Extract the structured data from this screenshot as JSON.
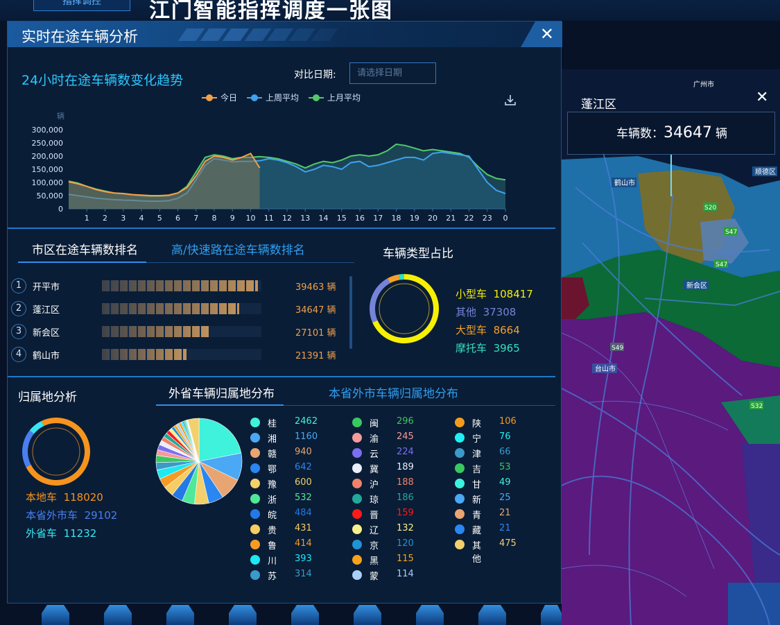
{
  "background": {
    "title": "江门智能指挥调度一张图",
    "nav_tab": "指挥调控"
  },
  "panel": {
    "title": "实时在途车辆分析",
    "close_icon": "close-icon"
  },
  "trend": {
    "title": "24小时在途车辆数变化趋势",
    "compare_label": "对比日期:",
    "date_placeholder": "请选择日期",
    "unit": "辆",
    "download_icon": "download-icon"
  },
  "ranking": {
    "tab_active": "市区在途车辆数排名",
    "tab_other": "高/快速路在途车辆数排名",
    "rows": [
      {
        "rank": "1",
        "name": "开平市",
        "value": 39463,
        "value_text": "39463 辆"
      },
      {
        "rank": "2",
        "name": "蓬江区",
        "value": 34647,
        "value_text": "34647 辆"
      },
      {
        "rank": "3",
        "name": "新会区",
        "value": 27101,
        "value_text": "27101 辆"
      },
      {
        "rank": "4",
        "name": "鹤山市",
        "value": 21391,
        "value_text": "21391 辆"
      }
    ]
  },
  "vehicle_type": {
    "title": "车辆类型占比",
    "items": [
      {
        "label": "小型车",
        "value": "108417",
        "color": "#f7f003"
      },
      {
        "label": "其他",
        "value": "37308",
        "color": "#7584d8"
      },
      {
        "label": "大型车",
        "value": "8664",
        "color": "#f5a127"
      },
      {
        "label": "摩托车",
        "value": "3965",
        "color": "#35e0bf"
      }
    ]
  },
  "origin": {
    "title": "归属地分析",
    "items": [
      {
        "label": "本地车",
        "value": "118020",
        "color": "#f7941d"
      },
      {
        "label": "本省外市车",
        "value": "29102",
        "color": "#4a7ff0"
      },
      {
        "label": "外省车",
        "value": "11232",
        "color": "#38e6f2"
      }
    ]
  },
  "provinces": {
    "tab_active": "外省车辆归属地分布",
    "tab_other": "本省外市车辆归属地分布",
    "items": [
      {
        "name": "桂",
        "value": "2462",
        "color": "#3ef2dc"
      },
      {
        "name": "湘",
        "value": "1160",
        "color": "#4aa8f5"
      },
      {
        "name": "赣",
        "value": "940",
        "color": "#e8a572"
      },
      {
        "name": "鄂",
        "value": "642",
        "color": "#2a86f0"
      },
      {
        "name": "豫",
        "value": "600",
        "color": "#f2d06b"
      },
      {
        "name": "浙",
        "value": "532",
        "color": "#4fe89a"
      },
      {
        "name": "皖",
        "value": "484",
        "color": "#2379e6"
      },
      {
        "name": "贵",
        "value": "431",
        "color": "#f6cd62"
      },
      {
        "name": "鲁",
        "value": "414",
        "color": "#f59b23"
      },
      {
        "name": "川",
        "value": "393",
        "color": "#1ee8f2"
      },
      {
        "name": "苏",
        "value": "314",
        "color": "#3a9ac8"
      },
      {
        "name": "闽",
        "value": "296",
        "color": "#38c860"
      },
      {
        "name": "渝",
        "value": "245",
        "color": "#f59a9a"
      },
      {
        "name": "云",
        "value": "224",
        "color": "#7b6ef0"
      },
      {
        "name": "冀",
        "value": "189",
        "color": "#e9eefc"
      },
      {
        "name": "沪",
        "value": "188",
        "color": "#f0826a"
      },
      {
        "name": "琼",
        "value": "186",
        "color": "#23a89a"
      },
      {
        "name": "晋",
        "value": "159",
        "color": "#ff1a1a"
      },
      {
        "name": "辽",
        "value": "132",
        "color": "#f8f08a"
      },
      {
        "name": "京",
        "value": "120",
        "color": "#1f93d4"
      },
      {
        "name": "黑",
        "value": "115",
        "color": "#f7a21b"
      },
      {
        "name": "蒙",
        "value": "114",
        "color": "#a8cff8"
      },
      {
        "name": "陕",
        "value": "106",
        "color": "#f39c1b"
      },
      {
        "name": "宁",
        "value": "76",
        "color": "#1ef0f5"
      },
      {
        "name": "津",
        "value": "66",
        "color": "#3a9ac8"
      },
      {
        "name": "吉",
        "value": "53",
        "color": "#38c860"
      },
      {
        "name": "甘",
        "value": "49",
        "color": "#3ef2dc"
      },
      {
        "name": "新",
        "value": "25",
        "color": "#4aa8f5"
      },
      {
        "name": "青",
        "value": "21",
        "color": "#e8a572"
      },
      {
        "name": "藏",
        "value": "21",
        "color": "#2a86f0"
      },
      {
        "name": "其他",
        "value": "475",
        "color": "#f2d06b"
      }
    ]
  },
  "popup": {
    "district": "蓬江区",
    "text": "车辆数：",
    "value": "34647",
    "unit": "辆"
  },
  "map_labels": [
    "鹤山市",
    "新会区",
    "台山市",
    "顺德区",
    "广州市",
    "S20",
    "S47",
    "S47",
    "S49",
    "S32"
  ],
  "chart_data": {
    "type": "area",
    "title": "24小时在途车辆数变化趋势",
    "ylabel": "辆",
    "ylim": [
      0,
      300000
    ],
    "y_ticks": [
      "300,000",
      "250,000",
      "200,000",
      "150,000",
      "100,000",
      "50,000",
      "0"
    ],
    "x_ticks": [
      "1",
      "2",
      "3",
      "4",
      "5",
      "6",
      "7",
      "8",
      "9",
      "10",
      "11",
      "12",
      "13",
      "14",
      "15",
      "16",
      "17",
      "18",
      "19",
      "20",
      "21",
      "22",
      "23",
      "0"
    ],
    "legend_position": "top",
    "series": [
      {
        "name": "今日",
        "color": "#f2a04a",
        "x": [
          0,
          0.5,
          1,
          1.5,
          2,
          2.5,
          3,
          3.5,
          4,
          4.5,
          5,
          5.5,
          6,
          6.5,
          7,
          7.5,
          8,
          8.5,
          9,
          9.5,
          10,
          10.5
        ],
        "values": [
          102000,
          95000,
          85000,
          73000,
          65000,
          60000,
          58000,
          54000,
          52000,
          50000,
          50000,
          52000,
          60000,
          80000,
          125000,
          180000,
          200000,
          195000,
          185000,
          195000,
          210000,
          155000
        ]
      },
      {
        "name": "上周平均",
        "color": "#3fa1ef",
        "x": [
          0,
          0.5,
          1,
          1.5,
          2,
          2.5,
          3,
          3.5,
          4,
          4.5,
          5,
          5.5,
          6,
          6.5,
          7,
          7.5,
          8,
          8.5,
          9,
          9.5,
          10,
          10.5,
          11,
          11.5,
          12,
          12.5,
          13,
          13.5,
          14,
          14.5,
          15,
          15.5,
          16,
          16.5,
          17,
          17.5,
          18,
          18.5,
          19,
          19.5,
          20,
          20.5,
          21,
          21.5,
          22,
          22.5,
          23,
          23.5,
          24
        ],
        "values": [
          55000,
          50000,
          45000,
          40000,
          37000,
          35000,
          33000,
          32000,
          30000,
          29000,
          29000,
          31000,
          40000,
          60000,
          110000,
          165000,
          190000,
          185000,
          178000,
          180000,
          180000,
          182000,
          190000,
          185000,
          175000,
          160000,
          140000,
          150000,
          165000,
          160000,
          150000,
          175000,
          180000,
          160000,
          165000,
          175000,
          185000,
          195000,
          195000,
          185000,
          210000,
          215000,
          210000,
          205000,
          200000,
          150000,
          100000,
          70000,
          58000
        ]
      },
      {
        "name": "上月平均",
        "color": "#52c96a",
        "x": [
          0,
          0.5,
          1,
          1.5,
          2,
          2.5,
          3,
          3.5,
          4,
          4.5,
          5,
          5.5,
          6,
          6.5,
          7,
          7.5,
          8,
          8.5,
          9,
          9.5,
          10,
          10.5,
          11,
          11.5,
          12,
          12.5,
          13,
          13.5,
          14,
          14.5,
          15,
          15.5,
          16,
          16.5,
          17,
          17.5,
          18,
          18.5,
          19,
          19.5,
          20,
          20.5,
          21,
          21.5,
          22,
          22.5,
          23,
          23.5,
          24
        ],
        "values": [
          105000,
          98000,
          85000,
          75000,
          67000,
          60000,
          57000,
          53000,
          50000,
          48000,
          48000,
          50000,
          60000,
          85000,
          140000,
          195000,
          205000,
          200000,
          190000,
          195000,
          195000,
          198000,
          195000,
          190000,
          180000,
          170000,
          155000,
          170000,
          180000,
          175000,
          185000,
          200000,
          205000,
          200000,
          205000,
          220000,
          245000,
          240000,
          230000,
          220000,
          225000,
          220000,
          215000,
          210000,
          195000,
          160000,
          130000,
          115000,
          110000
        ]
      }
    ]
  }
}
